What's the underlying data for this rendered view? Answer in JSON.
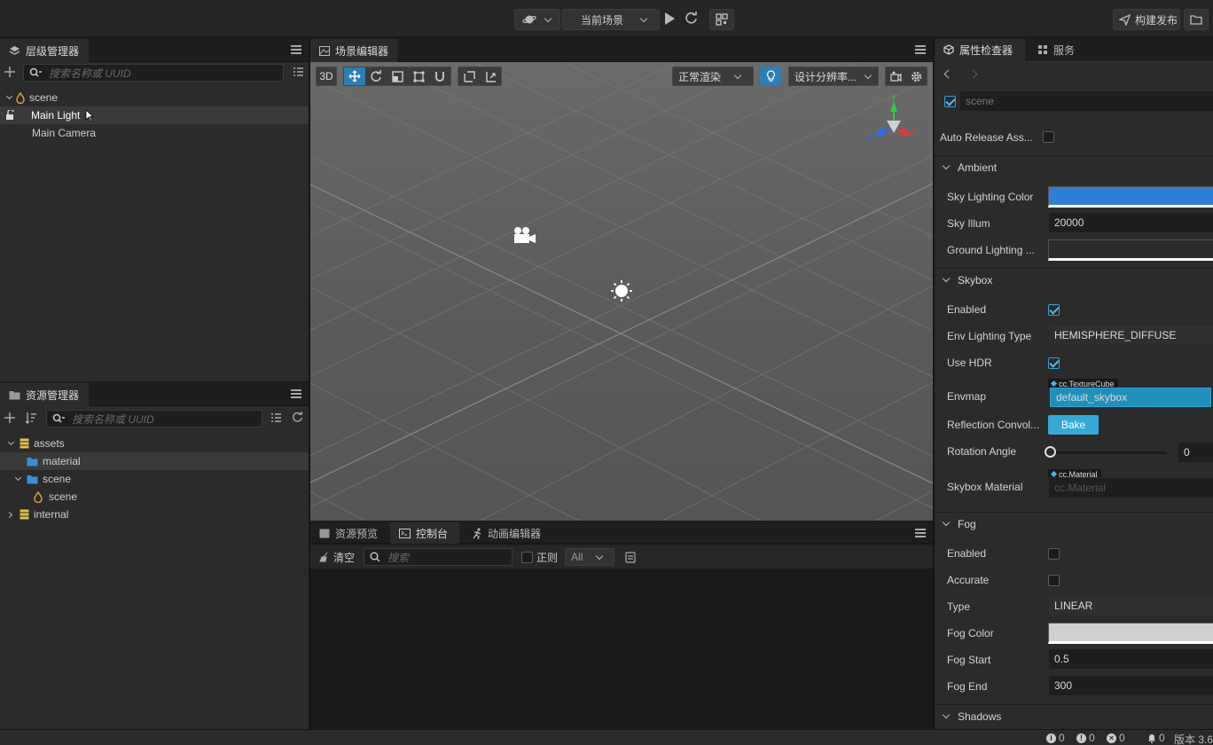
{
  "topbar": {
    "scene_select": "当前场景",
    "build_label": "构建发布"
  },
  "hierarchy": {
    "title": "层级管理器",
    "search_placeholder": "搜索名称或 UUID",
    "nodes": [
      "scene",
      "Main Light",
      "Main Camera"
    ]
  },
  "assets": {
    "title": "资源管理器",
    "search_placeholder": "搜索名称或 UUID",
    "nodes": [
      "assets",
      "material",
      "scene",
      "scene",
      "internal"
    ]
  },
  "scene_editor": {
    "title": "场景编辑器",
    "mode_3d": "3D",
    "render_mode": "正常渲染",
    "resolution": "设计分辨率..."
  },
  "bottom": {
    "tabs": [
      "资源预览",
      "控制台",
      "动画编辑器"
    ],
    "clear_label": "清空",
    "search_placeholder": "搜索",
    "regex_label": "正则",
    "filter_value": "All"
  },
  "inspector": {
    "tabs": [
      "属性检查器",
      "服务"
    ],
    "node_name": "scene",
    "auto_release_label": "Auto Release Ass...",
    "sections": {
      "ambient": "Ambient",
      "skybox": "Skybox",
      "fog": "Fog",
      "shadows": "Shadows"
    },
    "ambient": {
      "sky_color_label": "Sky Lighting Color",
      "sky_illum_label": "Sky Illum",
      "sky_illum_value": "20000",
      "ground_label": "Ground Lighting ..."
    },
    "skybox": {
      "enabled_label": "Enabled",
      "env_type_label": "Env Lighting Type",
      "env_type_value": "HEMISPHERE_DIFFUSE",
      "hdr_label": "Use HDR",
      "envmap_label": "Envmap",
      "envmap_type": "cc.TextureCube",
      "envmap_value": "default_skybox",
      "reflection_label": "Reflection Convol...",
      "bake_label": "Bake",
      "rotation_label": "Rotation Angle",
      "rotation_value": "0",
      "material_label": "Skybox Material",
      "material_type": "cc.Material",
      "material_placeholder": "cc.Material"
    },
    "fog": {
      "enabled_label": "Enabled",
      "accurate_label": "Accurate",
      "type_label": "Type",
      "type_value": "LINEAR",
      "color_label": "Fog Color",
      "start_label": "Fog Start",
      "start_value": "0.5",
      "end_label": "Fog End",
      "end_value": "300"
    }
  },
  "status": {
    "info_count": "0",
    "warn_count": "0",
    "error_count": "0",
    "notify_count": "0",
    "version": "版本 3.6"
  },
  "colors": {
    "accent": "#2a9fd6",
    "sky_color": "#2f7fd6",
    "fog_color": "#d0d0d0"
  }
}
